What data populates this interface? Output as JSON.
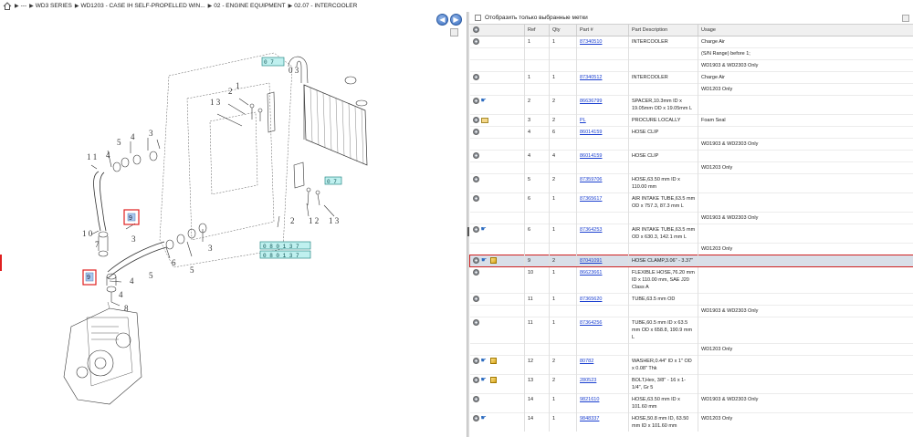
{
  "breadcrumb": {
    "items": [
      "---",
      "WD3 SERIES",
      "WD1203 - CASE IH SELF-PROPELLED WIN...",
      "02 - ENGINE EQUIPMENT",
      "02.07 - INTERCOOLER"
    ]
  },
  "diagram": {
    "nav_back": "◀",
    "nav_forward": "▶",
    "callouts": [
      "1",
      "2",
      "13",
      "1",
      "2",
      "13",
      "5",
      "4",
      "3",
      "11",
      "10",
      "9",
      "7",
      "3",
      "4",
      "5",
      "3",
      "6",
      "4",
      "8",
      "9",
      "3"
    ],
    "ref_boxes": [
      "0 7 0 3",
      "0 7 0 3",
      "0 8 0 1 3 7",
      "0 8 0 1 3 7"
    ]
  },
  "filter": {
    "label": "Отобразить только выбранные метки",
    "checked": false
  },
  "columns": [
    "",
    "Ref",
    "Qty",
    "Part #",
    "Part Description",
    "Usage"
  ],
  "rows": [
    {
      "icons": [
        "gear"
      ],
      "ref": "1",
      "qty": "1",
      "part": "87340510",
      "desc": "INTERCOOLER",
      "usage": "Charge Air"
    },
    {
      "icons": [],
      "ref": "",
      "qty": "",
      "part": "",
      "desc": "",
      "usage": "(S/N Range) before 1;"
    },
    {
      "icons": [],
      "ref": "",
      "qty": "",
      "part": "",
      "desc": "",
      "usage": "WD1903 & WD2303 Only"
    },
    {
      "icons": [
        "gear"
      ],
      "ref": "1",
      "qty": "1",
      "part": "87340512",
      "desc": "INTERCOOLER",
      "usage": "Charge Air"
    },
    {
      "icons": [],
      "ref": "",
      "qty": "",
      "part": "",
      "desc": "",
      "usage": "WD1203 Only"
    },
    {
      "icons": [
        "gear",
        "hand"
      ],
      "ref": "2",
      "qty": "2",
      "part": "86636799",
      "desc": "SPACER,10.3mm ID x 19.05mm OD x 19.05mm L",
      "usage": ""
    },
    {
      "icons": [
        "gear",
        "envelope"
      ],
      "ref": "3",
      "qty": "2",
      "part": "PL",
      "desc": "PROCURE LOCALLY",
      "usage": "Foam Seal"
    },
    {
      "icons": [
        "gear"
      ],
      "ref": "4",
      "qty": "6",
      "part": "86014159",
      "desc": "HOSE CLIP",
      "usage": ""
    },
    {
      "icons": [],
      "ref": "",
      "qty": "",
      "part": "",
      "desc": "",
      "usage": "WD1903 & WD2303 Only"
    },
    {
      "icons": [
        "gear"
      ],
      "ref": "4",
      "qty": "4",
      "part": "86014159",
      "desc": "HOSE CLIP",
      "usage": ""
    },
    {
      "icons": [],
      "ref": "",
      "qty": "",
      "part": "",
      "desc": "",
      "usage": "WD1203 Only"
    },
    {
      "icons": [
        "gear"
      ],
      "ref": "5",
      "qty": "2",
      "part": "87359706",
      "desc": "HOSE,63.50 mm ID x 110.00 mm",
      "usage": ""
    },
    {
      "icons": [
        "gear"
      ],
      "ref": "6",
      "qty": "1",
      "part": "87365617",
      "desc": "AIR INTAKE TUBE,63.5 mm OD x 757.3, 87.3 mm L",
      "usage": ""
    },
    {
      "icons": [],
      "ref": "",
      "qty": "",
      "part": "",
      "desc": "",
      "usage": "WD1903 & WD2303 Only"
    },
    {
      "icons": [
        "gear",
        "hand"
      ],
      "ref": "6",
      "qty": "1",
      "part": "87364253",
      "desc": "AIR INTAKE TUBE,63.5 mm OD x 630.3, 142.1 mm L",
      "usage": ""
    },
    {
      "icons": [],
      "ref": "",
      "qty": "",
      "part": "",
      "desc": "",
      "usage": "WD1203 Only"
    },
    {
      "icons": [
        "gear",
        "hand",
        "cube"
      ],
      "ref": "9",
      "qty": "2",
      "part": "87041091",
      "desc": "HOSE CLAMP,3.06\" - 3.37\"",
      "usage": "",
      "selected": true
    },
    {
      "icons": [
        "gear"
      ],
      "ref": "10",
      "qty": "1",
      "part": "86623661",
      "desc": "FLEXIBLE HOSE,76.20 mm ID x 110.00 mm, SAE J20 Class A",
      "usage": ""
    },
    {
      "icons": [
        "gear"
      ],
      "ref": "11",
      "qty": "1",
      "part": "87365620",
      "desc": "TUBE,63.5 mm OD",
      "usage": ""
    },
    {
      "icons": [],
      "ref": "",
      "qty": "",
      "part": "",
      "desc": "",
      "usage": "WD1903 & WD2303 Only"
    },
    {
      "icons": [
        "gear"
      ],
      "ref": "11",
      "qty": "1",
      "part": "87364256",
      "desc": "TUBE,60.5 mm ID x 63.5 mm OD x 658.8, 190.9 mm L",
      "usage": ""
    },
    {
      "icons": [],
      "ref": "",
      "qty": "",
      "part": "",
      "desc": "",
      "usage": "WD1203 Only"
    },
    {
      "icons": [
        "gear",
        "hand",
        "cube"
      ],
      "ref": "12",
      "qty": "2",
      "part": "80782",
      "desc": "WASHER,0.44\" ID x 1\" OD x 0.08\" Thk",
      "usage": ""
    },
    {
      "icons": [
        "gear",
        "hand",
        "cube"
      ],
      "ref": "13",
      "qty": "2",
      "part": "280523",
      "desc": "BOLT,Hex, 3/8\" - 16 x 1-1/4\", Gr 5",
      "usage": ""
    },
    {
      "icons": [
        "gear"
      ],
      "ref": "14",
      "qty": "1",
      "part": "9821610",
      "desc": "HOSE,63.50 mm ID x 101.60 mm",
      "usage": "WD1903 & WD2303 Only"
    },
    {
      "icons": [
        "gear",
        "hand"
      ],
      "ref": "14",
      "qty": "1",
      "part": "9848337",
      "desc": "HOSE,50.8 mm ID, 63.50 mm ID x 101.60 mm",
      "usage": "WD1203 Only"
    }
  ]
}
